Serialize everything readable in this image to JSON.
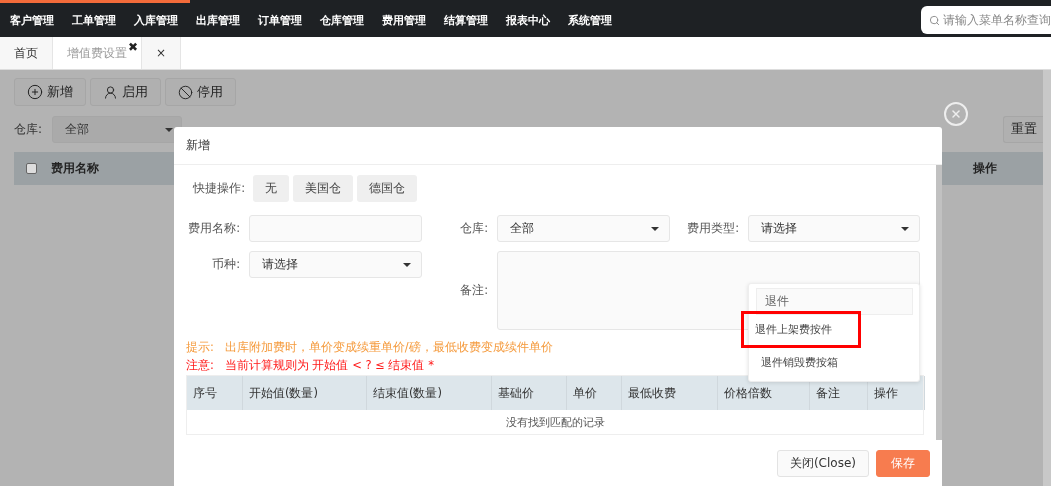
{
  "nav": {
    "items": [
      "客户管理",
      "工单管理",
      "入库管理",
      "出库管理",
      "订单管理",
      "仓库管理",
      "费用管理",
      "结算管理",
      "报表中心",
      "系统管理"
    ],
    "search": {
      "placeholder": "请输入菜单名称查询"
    }
  },
  "tabs": [
    {
      "label": "首页",
      "selected": false
    },
    {
      "label": "增值费设置",
      "selected": true,
      "close": "✖"
    },
    {
      "label": "×",
      "selected": false
    }
  ],
  "toolbar": [
    {
      "label": "新增",
      "kind": "add"
    },
    {
      "label": "启用",
      "kind": "enable"
    },
    {
      "label": "停用",
      "kind": "disable"
    }
  ],
  "filter": {
    "label": "仓库:",
    "value": "全部",
    "reset": "重置"
  },
  "table": {
    "checked": false,
    "columns": [
      "费用名称",
      "操作"
    ]
  },
  "modal": {
    "title": "新增",
    "quick": {
      "label": "快捷操作:",
      "buttons": [
        "无",
        "美国仓",
        "德国仓"
      ]
    },
    "fields": [
      {
        "label": "费用名称:",
        "kind": "input"
      },
      {
        "label": "仓库:",
        "kind": "select",
        "value": "全部"
      },
      {
        "label": "费用类型:",
        "kind": "select",
        "value": "请选择"
      },
      {
        "label": "币种:",
        "kind": "select",
        "value": "请选择"
      },
      {
        "label": "备注:",
        "kind": "textarea"
      }
    ],
    "dropdown": {
      "search": "退件",
      "options": [
        {
          "label": "退件上架费按件",
          "annotated": true
        },
        {
          "label": "退件销毁费按箱",
          "annotated": false
        }
      ]
    },
    "hint": {
      "label": "提示:",
      "text": "出库附加费时，单价变成续重单价/磅，最低收费变成续件单价"
    },
    "note": {
      "label": "注意:",
      "text": "当前计算规则为 开始值 < ? ≤ 结束值 *"
    },
    "columns": [
      "序号",
      "开始值(数量)",
      "结束值(数量)",
      "基础价",
      "单价",
      "最低收费",
      "价格倍数",
      "备注",
      "操作"
    ],
    "empty": "没有找到匹配的记录",
    "buttons": [
      {
        "label": "关闭(Close)",
        "kind": "default"
      },
      {
        "label": "保存",
        "kind": "primary"
      }
    ]
  }
}
